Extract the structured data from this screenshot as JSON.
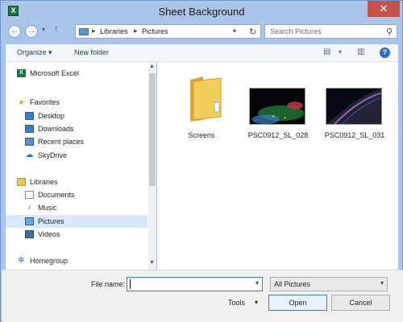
{
  "window": {
    "title": "Sheet Background",
    "app_icon_letter": "X",
    "close_glyph": "✕"
  },
  "nav": {
    "back_glyph": "←",
    "forward_glyph": "→",
    "recent_glyph": "▾",
    "up_glyph": "↑",
    "breadcrumb": [
      "Libraries",
      "Pictures"
    ],
    "separator": "▸",
    "refresh_glyph": "↻",
    "search_placeholder": "Search Pictures",
    "search_glyph": "⚲"
  },
  "toolbar": {
    "organize_label": "Organize",
    "organize_caret": "▾",
    "new_folder_label": "New folder",
    "view_glyph": "▤",
    "view_caret": "▾",
    "preview_glyph": "▥",
    "help_glyph": "?"
  },
  "sidebar": {
    "items": [
      {
        "label": "Microsoft Excel",
        "icon": "excel-icon"
      },
      {
        "label": "Favorites",
        "icon": "star-icon"
      },
      {
        "label": "Desktop",
        "icon": "desktop-icon"
      },
      {
        "label": "Downloads",
        "icon": "downloads-icon"
      },
      {
        "label": "Recent places",
        "icon": "recent-places-icon"
      },
      {
        "label": "SkyDrive",
        "icon": "cloud-icon"
      },
      {
        "label": "Libraries",
        "icon": "libraries-icon"
      },
      {
        "label": "Documents",
        "icon": "documents-icon"
      },
      {
        "label": "Music",
        "icon": "music-icon"
      },
      {
        "label": "Pictures",
        "icon": "pictures-icon"
      },
      {
        "label": "Videos",
        "icon": "videos-icon"
      },
      {
        "label": "Homegroup",
        "icon": "homegroup-icon"
      }
    ],
    "selected": "Pictures",
    "scroll_up_glyph": "▲",
    "scroll_down_glyph": "▼"
  },
  "files": [
    {
      "name": "Screens",
      "type": "folder"
    },
    {
      "name": "PSC0912_SL_028",
      "type": "image"
    },
    {
      "name": "PSC0912_SL_031",
      "type": "image"
    }
  ],
  "footer": {
    "file_name_label": "File name:",
    "file_name_value": "",
    "file_name_caret": "▾",
    "filter_value": "All Pictures",
    "filter_caret": "▾",
    "tools_label": "Tools",
    "tools_caret": "▾",
    "open_label": "Open",
    "cancel_label": "Cancel"
  },
  "colors": {
    "frame": "#a9c6ea",
    "close_button": "#c7504a",
    "selection": "#d9e8fb",
    "folder_yellow": "#f2cf5b"
  }
}
